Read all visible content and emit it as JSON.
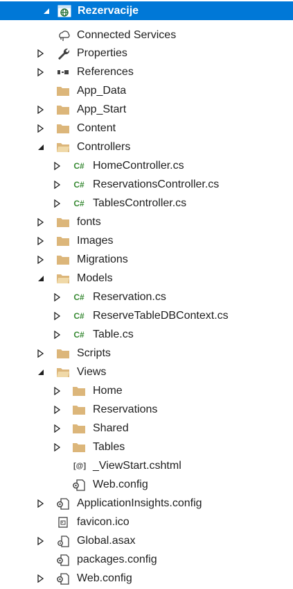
{
  "project": {
    "label": "Rezervacije"
  },
  "nodes": {
    "connected_services": "Connected Services",
    "properties": "Properties",
    "references": "References",
    "app_data": "App_Data",
    "app_start": "App_Start",
    "content": "Content",
    "controllers": "Controllers",
    "home_controller": "HomeController.cs",
    "reservations_controller": "ReservationsController.cs",
    "tables_controller": "TablesController.cs",
    "fonts": "fonts",
    "images": "Images",
    "migrations": "Migrations",
    "models": "Models",
    "reservation_cs": "Reservation.cs",
    "reserve_table_context": "ReserveTableDBContext.cs",
    "table_cs": "Table.cs",
    "scripts": "Scripts",
    "views": "Views",
    "views_home": "Home",
    "views_reservations": "Reservations",
    "views_shared": "Shared",
    "views_tables": "Tables",
    "viewstart": "_ViewStart.cshtml",
    "views_web_config": "Web.config",
    "app_insights": "ApplicationInsights.config",
    "favicon": "favicon.ico",
    "global_asax": "Global.asax",
    "packages_config": "packages.config",
    "web_config": "Web.config"
  },
  "icons": {
    "cs_glyph": "C#",
    "viewstart_glyph": "[@]"
  },
  "colors": {
    "selection": "#0078d7",
    "folder": "#dcb67a",
    "csharp": "#388a34",
    "arrow": "#1e1e1e"
  }
}
